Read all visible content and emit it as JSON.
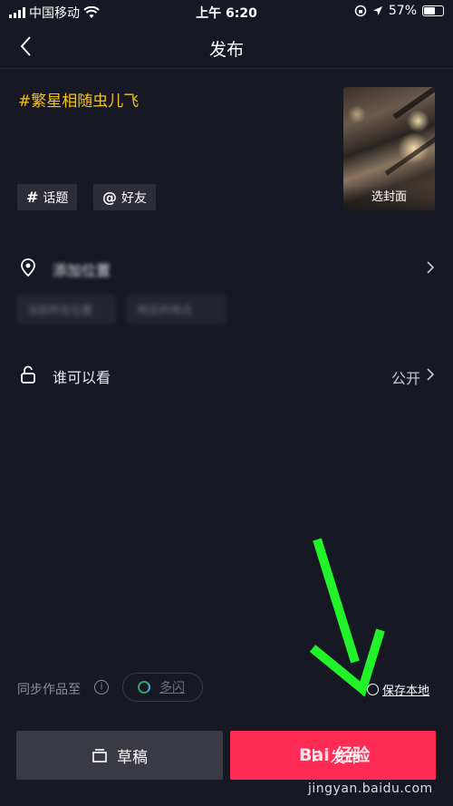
{
  "status_bar": {
    "carrier": "中国移动",
    "time": "上午 6:20",
    "battery": "57%",
    "icons": [
      "signal-icon",
      "wifi-icon",
      "lock-rotation-icon",
      "location-icon",
      "battery-icon"
    ]
  },
  "navbar": {
    "title": "发布",
    "back_icon": "chevron-left-icon"
  },
  "post": {
    "hashtag_text": "#繁星相随虫儿飞",
    "cover_label": "选封面",
    "topic_chip": {
      "symbol": "#",
      "label": "话题"
    },
    "friend_chip": {
      "symbol": "@",
      "label": "好友"
    }
  },
  "location": {
    "label": "添加位置",
    "suggestions": [
      "当前所在位置",
      "附近的地点"
    ]
  },
  "visibility": {
    "label": "谁可以看",
    "value": "公开"
  },
  "sync": {
    "label": "同步作品至",
    "info_icon": "i",
    "target": "多闪"
  },
  "save_local": {
    "label": "保存本地",
    "checked": false
  },
  "actions": {
    "draft_label": "草稿",
    "publish_label": "发布"
  },
  "watermark": {
    "text": "Bai 经验",
    "url": "jingyan.baidu.com"
  },
  "colors": {
    "background": "#161823",
    "hashtag": "#f5c215",
    "publish": "#fe2c55",
    "draft": "#393a44",
    "arrow": "#22f22a"
  }
}
